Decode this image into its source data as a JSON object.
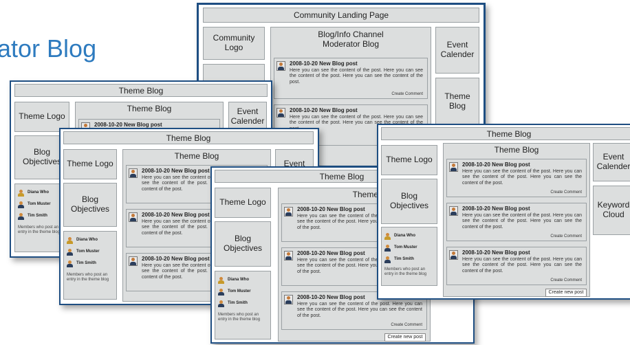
{
  "heading": "ator Blog",
  "post": {
    "title": "2008-10-20 New Blog post",
    "body": "Here you can see the content of the post. Here you can see the content of the post. Here you can see the content of the post.",
    "create": "Create Comment"
  },
  "members": {
    "names": [
      "Diana Who",
      "Tom Muster",
      "Tim Smith"
    ],
    "note": "Members who post an entry in the theme blog"
  },
  "create_post": "Create new post",
  "community": {
    "title": "Community Landing Page",
    "logo": "Community Logo",
    "channel": "Blog/Info Channel Moderator Blog",
    "calendar": "Event Calender",
    "theme_blog": "Theme Blog"
  },
  "theme": {
    "title": "Theme Blog",
    "logo": "Theme Logo",
    "objectives": "Blog Objectives",
    "column": "Theme Blog",
    "calendar": "Event Calender",
    "keyword": "Keyword Cloud",
    "event_short": "Event",
    "calendar_cut": "Calender"
  }
}
